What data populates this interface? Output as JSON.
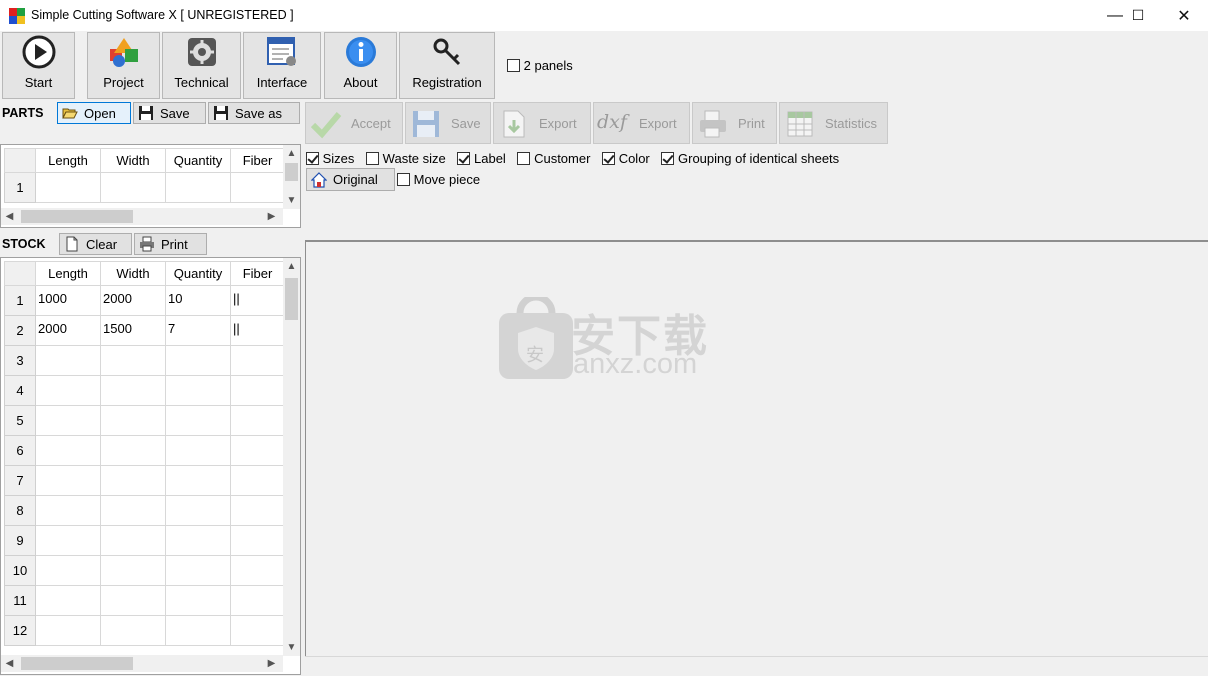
{
  "window": {
    "title": "Simple Cutting Software X [ UNREGISTERED ]",
    "min_glyph": "—",
    "max_glyph": "☐",
    "close_glyph": "✕"
  },
  "toolbar": {
    "start": "Start",
    "project": "Project",
    "technical": "Technical",
    "interface": "Interface",
    "about": "About",
    "registration": "Registration",
    "two_panels": "2 panels",
    "two_panels_checked": false
  },
  "parts": {
    "section": "PARTS",
    "open": "Open",
    "save": "Save",
    "save_as": "Save as",
    "columns": [
      "Length",
      "Width",
      "Quantity",
      "Fiber"
    ],
    "rows": [
      {
        "num": "1",
        "cells": [
          "",
          "",
          "",
          ""
        ]
      }
    ]
  },
  "stock": {
    "section": "STOCK",
    "clear": "Clear",
    "print": "Print",
    "columns": [
      "Length",
      "Width",
      "Quantity",
      "Fiber"
    ],
    "rows": [
      {
        "num": "1",
        "cells": [
          "1000",
          "2000",
          "10",
          "||"
        ]
      },
      {
        "num": "2",
        "cells": [
          "2000",
          "1500",
          "7",
          "||"
        ]
      },
      {
        "num": "3",
        "cells": [
          "",
          "",
          "",
          ""
        ]
      },
      {
        "num": "4",
        "cells": [
          "",
          "",
          "",
          ""
        ]
      },
      {
        "num": "5",
        "cells": [
          "",
          "",
          "",
          ""
        ]
      },
      {
        "num": "6",
        "cells": [
          "",
          "",
          "",
          ""
        ]
      },
      {
        "num": "7",
        "cells": [
          "",
          "",
          "",
          ""
        ]
      },
      {
        "num": "8",
        "cells": [
          "",
          "",
          "",
          ""
        ]
      },
      {
        "num": "9",
        "cells": [
          "",
          "",
          "",
          ""
        ]
      },
      {
        "num": "10",
        "cells": [
          "",
          "",
          "",
          ""
        ]
      },
      {
        "num": "11",
        "cells": [
          "",
          "",
          "",
          ""
        ]
      },
      {
        "num": "12",
        "cells": [
          "",
          "",
          "",
          ""
        ]
      }
    ]
  },
  "result_toolbar": {
    "accept": "Accept",
    "save": "Save",
    "export": "Export",
    "dxf_export": "Export",
    "dxf_text": "dxf",
    "print": "Print",
    "statistics": "Statistics"
  },
  "options": {
    "sizes": {
      "label": "Sizes",
      "checked": true
    },
    "waste_size": {
      "label": "Waste size",
      "checked": false
    },
    "label": {
      "label": "Label",
      "checked": true
    },
    "customer": {
      "label": "Customer",
      "checked": false
    },
    "color": {
      "label": "Color",
      "checked": true
    },
    "grouping": {
      "label": "Grouping of identical sheets",
      "checked": true
    },
    "original": "Original",
    "move_piece": {
      "label": "Move piece",
      "checked": false
    }
  },
  "watermark": {
    "cn_text": "安下载",
    "domain": "anxz.com",
    "shield_char": "安"
  },
  "colors": {
    "window_bg": "#f0f0f0",
    "grid_line": "#d8d8d8",
    "disabled_text": "#9a9a9a"
  }
}
